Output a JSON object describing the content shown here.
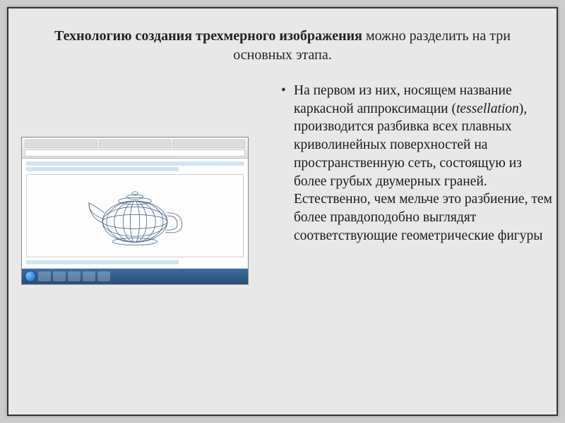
{
  "title": {
    "bold": "Технологию создания трехмерного изображения",
    "rest": " можно разделить на три основных этапа."
  },
  "bullet": {
    "part1": "На первом из них, носящем название каркасной аппроксимации (",
    "italic": "tessellation",
    "part2": "), производится разбивка всех плавных криволинейных поверхностей на пространственную сеть, состоящую из более грубых двумерных граней. Естественно, чем мельче это разбиение, тем более правдоподобно выглядят соответствующие геометрические фигуры"
  }
}
